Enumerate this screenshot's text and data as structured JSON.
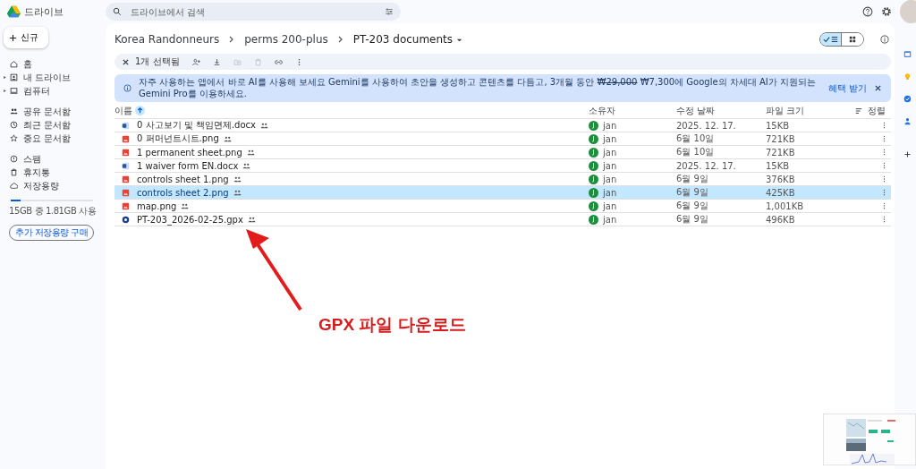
{
  "app": {
    "title": "드라이브"
  },
  "search": {
    "placeholder": "드라이브에서 검색"
  },
  "new_button": {
    "label": "신규"
  },
  "sidebar": {
    "sections": [
      {
        "items": [
          {
            "kind": "home",
            "label": "홈",
            "expandable": false
          },
          {
            "kind": "drive",
            "label": "내 드라이브",
            "expandable": true
          },
          {
            "kind": "computer",
            "label": "컴퓨터",
            "expandable": true
          }
        ]
      },
      {
        "items": [
          {
            "kind": "shared",
            "label": "공유 문서함",
            "expandable": false
          },
          {
            "kind": "recent",
            "label": "최근 문서함",
            "expandable": false
          },
          {
            "kind": "starred",
            "label": "중요 문서함",
            "expandable": false
          }
        ]
      },
      {
        "items": [
          {
            "kind": "spam",
            "label": "스팸",
            "expandable": false
          },
          {
            "kind": "trash",
            "label": "휴지통",
            "expandable": false
          },
          {
            "kind": "storage",
            "label": "저장용량",
            "expandable": false
          }
        ]
      }
    ],
    "storage": {
      "level": 0.12,
      "text": "15GB 중 1.81GB 사용"
    },
    "buy_button": "추가 저장용량 구매"
  },
  "breadcrumb": [
    {
      "label": "Korea Randonneurs"
    },
    {
      "label": "perms 200-plus"
    },
    {
      "label": "PT-203 documents"
    }
  ],
  "views": [
    {
      "kind": "list",
      "selected": true
    },
    {
      "kind": "grid",
      "selected": false
    }
  ],
  "toolbar": {
    "selection": "1개 선택됨",
    "actions": [
      {
        "kind": "share",
        "disabled": false
      },
      {
        "kind": "download",
        "disabled": false
      },
      {
        "kind": "move",
        "disabled": true
      },
      {
        "kind": "trash",
        "disabled": true
      },
      {
        "kind": "link",
        "disabled": false
      },
      {
        "kind": "more",
        "disabled": false
      }
    ]
  },
  "banner": {
    "parts": [
      {
        "kind": "plain",
        "text": "자주 사용하는 앱에서 바로 AI를 사용해 보세요 Gemini를 사용하여 초안을 생성하고 콘텐츠를 다듬고, 3개월 동안 "
      },
      {
        "kind": "struck",
        "text": "₩29,000"
      },
      {
        "kind": "plain",
        "text": " ₩7,300에 Google의 차세대 AI가 지원되는 Gemini Pro를 이용하세요."
      }
    ],
    "action": "혜택 받기"
  },
  "table": {
    "columns": [
      "이름",
      "소유자",
      "수정 날짜",
      "파일 크기"
    ],
    "sort_label": "정렬",
    "rows": [
      {
        "kind": "docx",
        "name": "0 사고보기 및 책임면제.docx",
        "owner": "jan",
        "avatar": "J",
        "modified": "2025. 12. 17.",
        "size": "15KB",
        "selected": false
      },
      {
        "kind": "png",
        "name": "0 퍼머넌트시트.png",
        "owner": "jan",
        "avatar": "J",
        "modified": "6월 10일",
        "size": "721KB",
        "selected": false
      },
      {
        "kind": "png",
        "name": "1 permanent sheet.png",
        "owner": "jan",
        "avatar": "J",
        "modified": "6월 10일",
        "size": "721KB",
        "selected": false
      },
      {
        "kind": "docx",
        "name": "1 waiver form EN.docx",
        "owner": "jan",
        "avatar": "J",
        "modified": "2025. 12. 17.",
        "size": "15KB",
        "selected": false
      },
      {
        "kind": "png",
        "name": "controls sheet 1.png",
        "owner": "jan",
        "avatar": "J",
        "modified": "6월 9일",
        "size": "376KB",
        "selected": false
      },
      {
        "kind": "png",
        "name": "controls sheet 2.png",
        "owner": "jan",
        "avatar": "J",
        "modified": "6월 9일",
        "size": "425KB",
        "selected": true
      },
      {
        "kind": "png",
        "name": "map.png",
        "owner": "jan",
        "avatar": "J",
        "modified": "6월 9일",
        "size": "1,001KB",
        "selected": false
      },
      {
        "kind": "gpx",
        "name": "PT-203_2026-02-25.gpx",
        "owner": "jan",
        "avatar": "J",
        "modified": "6월 9일",
        "size": "496KB",
        "selected": false
      }
    ]
  },
  "annotation": {
    "label": "GPX 파일 다운로드"
  },
  "rail": [
    {
      "kind": "calendar"
    },
    {
      "kind": "keep"
    },
    {
      "kind": "tasks"
    },
    {
      "kind": "contacts"
    },
    {
      "kind": "add"
    }
  ]
}
